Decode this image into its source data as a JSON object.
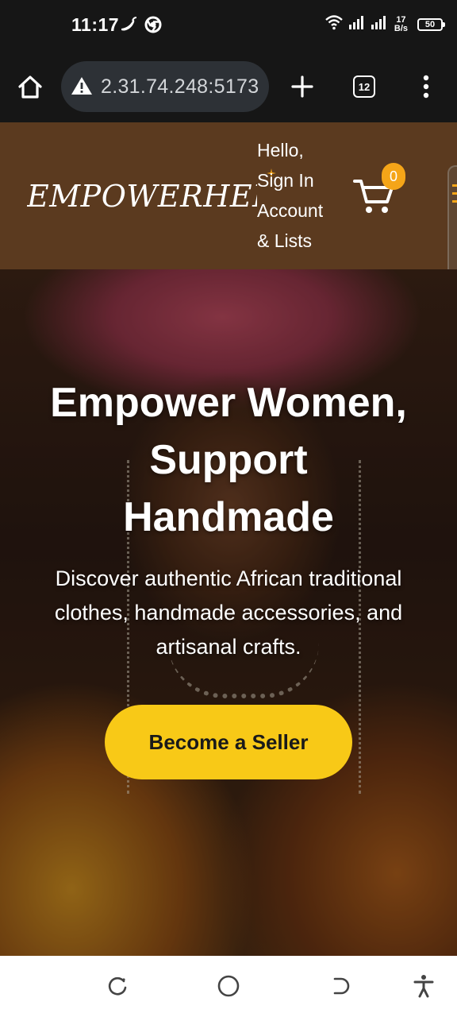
{
  "status_bar": {
    "time": "11:17",
    "net_speed_value": "17",
    "net_speed_unit": "B/s",
    "battery_level": "50",
    "icons": [
      "chili-icon",
      "chrome-icon",
      "wifi-icon",
      "signal-icon",
      "signal-icon"
    ]
  },
  "browser": {
    "url": "2.31.74.248:5173",
    "tab_count": "12",
    "icons": [
      "home-icon",
      "warning-icon",
      "plus-icon",
      "tabs-icon",
      "more-vertical-icon"
    ]
  },
  "header": {
    "logo": "EMPOWERHER",
    "account": [
      "Hello,",
      "Sign In",
      "Account",
      "& Lists"
    ],
    "cart_count": "0",
    "accent_color": "#f5a518",
    "background_color": "#5b3a1f"
  },
  "hero": {
    "title_lines": [
      "Empower Women,",
      "Support",
      "Handmade"
    ],
    "subtitle_lines": [
      "Discover authentic African traditional",
      "clothes, handmade accessories, and",
      "artisanal crafts."
    ],
    "cta_label": "Become a Seller",
    "cta_color": "#f8c917"
  },
  "nav_bar": {
    "icons": [
      "recents-icon",
      "home-circle-icon",
      "back-icon",
      "accessibility-icon"
    ]
  }
}
